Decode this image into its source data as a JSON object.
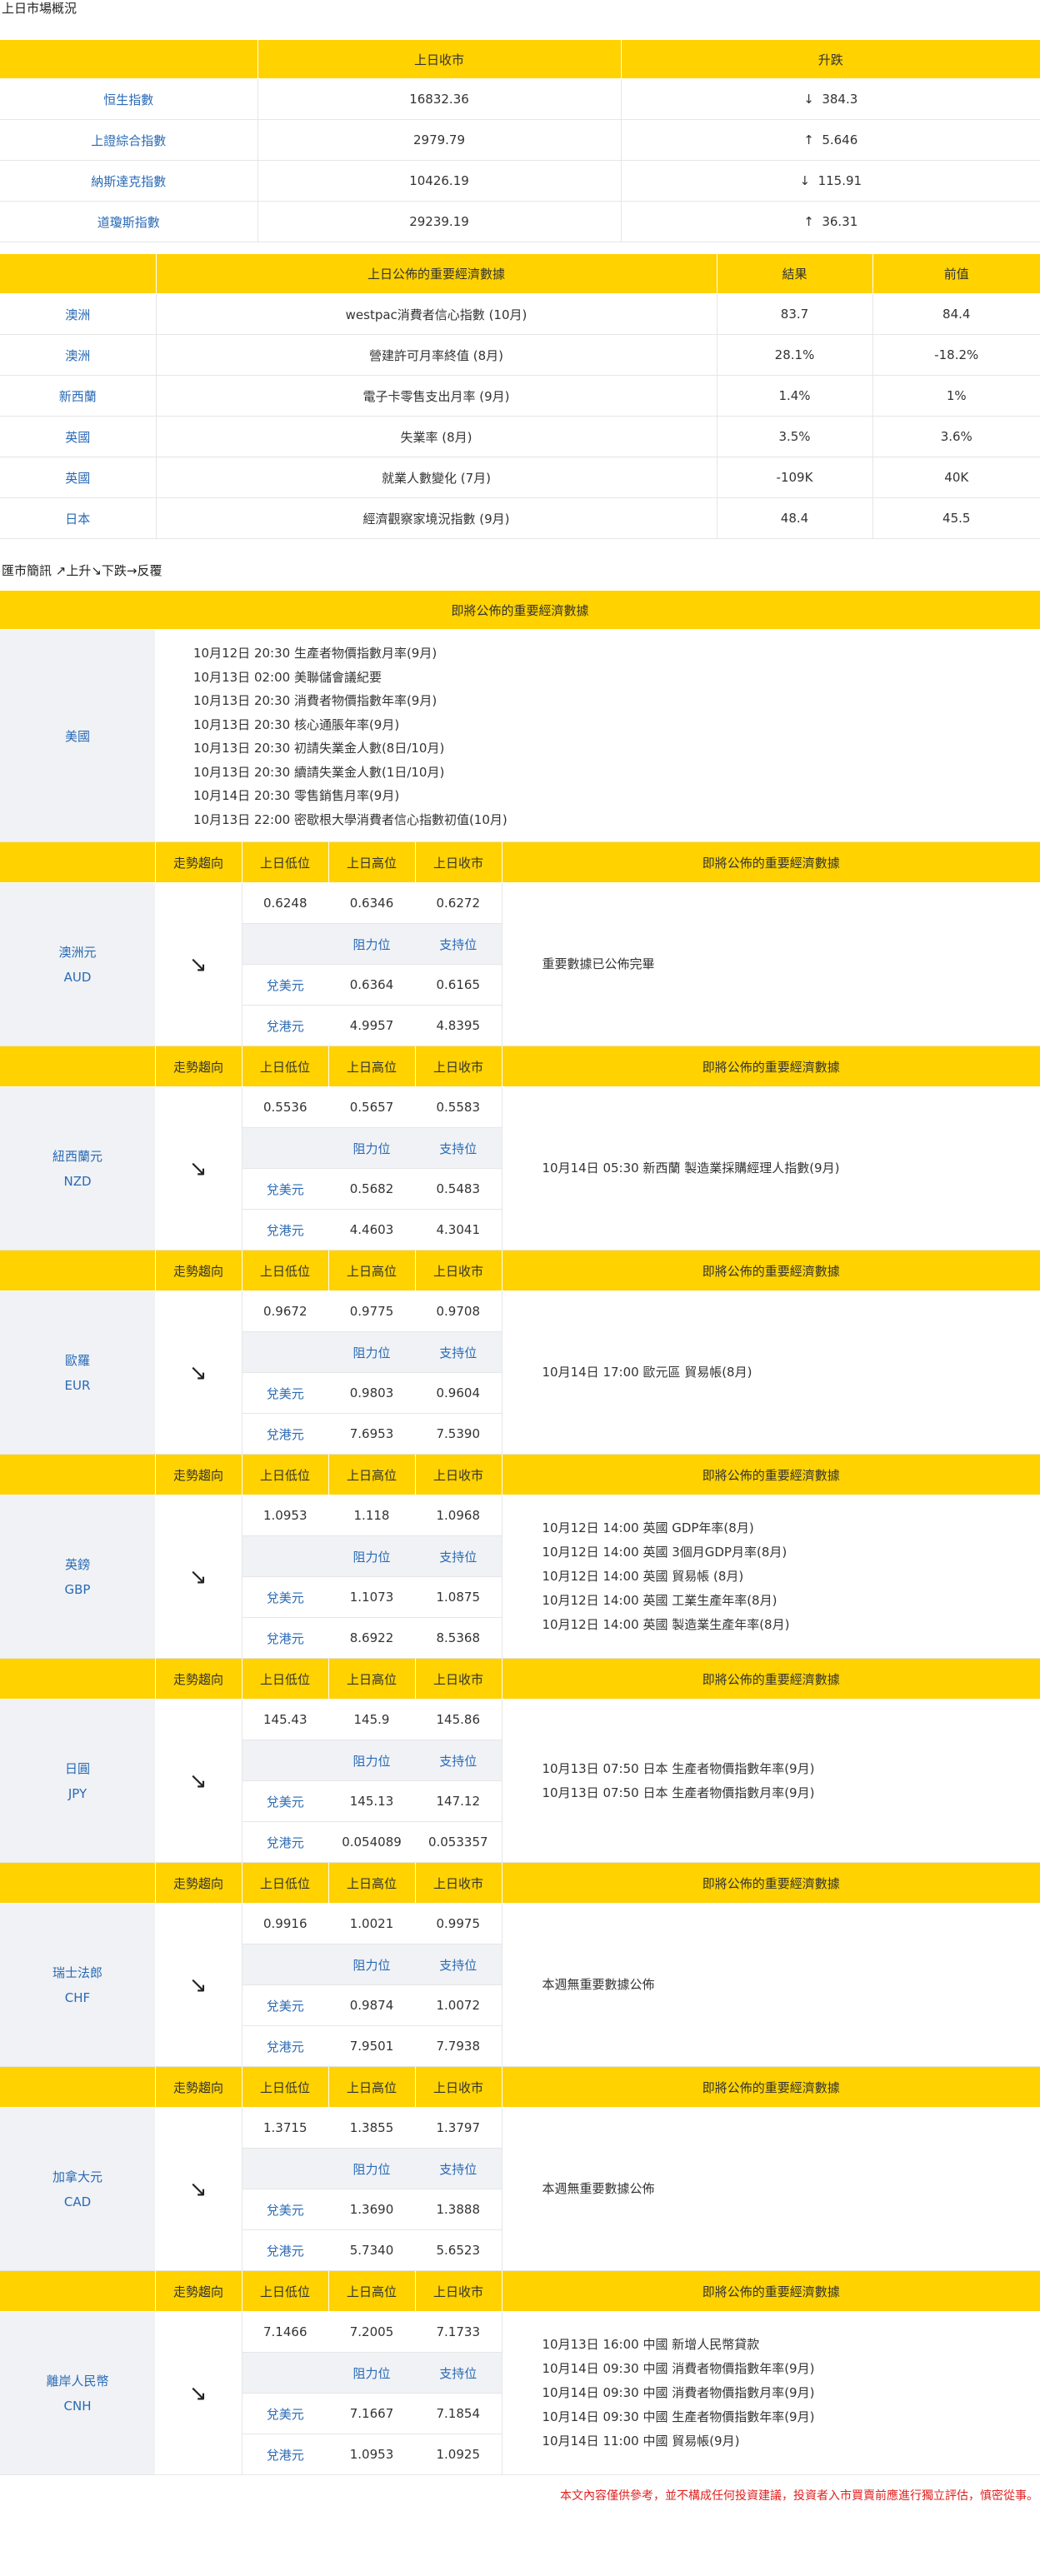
{
  "overview": {
    "title": "上日市場概況",
    "headers": [
      "",
      "上日收市",
      "升跌"
    ],
    "rows": [
      {
        "name": "恒生指數",
        "close": "16832.36",
        "dir": "↓",
        "change": "384.3"
      },
      {
        "name": "上證綜合指數",
        "close": "2979.79",
        "dir": "↑",
        "change": "5.646"
      },
      {
        "name": "納斯達克指數",
        "close": "10426.19",
        "dir": "↓",
        "change": "115.91"
      },
      {
        "name": "道瓊斯指數",
        "close": "29239.19",
        "dir": "↑",
        "change": "36.31"
      }
    ]
  },
  "economic": {
    "headers": [
      "",
      "上日公佈的重要經濟數據",
      "結果",
      "前值"
    ],
    "rows": [
      {
        "country": "澳洲",
        "item": "westpac消費者信心指數 (10月)",
        "result": "83.7",
        "prev": "84.4"
      },
      {
        "country": "澳洲",
        "item": "營建許可月率終值 (8月)",
        "result": "28.1%",
        "prev": "-18.2%"
      },
      {
        "country": "新西蘭",
        "item": "電子卡零售支出月率 (9月)",
        "result": "1.4%",
        "prev": "1%"
      },
      {
        "country": "英國",
        "item": "失業率 (8月)",
        "result": "3.5%",
        "prev": "3.6%"
      },
      {
        "country": "英國",
        "item": "就業人數變化 (7月)",
        "result": "-109K",
        "prev": "40K"
      },
      {
        "country": "日本",
        "item": "經濟觀察家境況指數 (9月)",
        "result": "48.4",
        "prev": "45.5"
      }
    ]
  },
  "fx": {
    "title": "匯市簡訊 ↗上升↘下跌→反覆",
    "us": {
      "header": "即將公佈的重要經濟數據",
      "country": "美國",
      "events": [
        "10月12日 20:30 生產者物價指數月率(9月)",
        "10月13日 02:00 美聯儲會議紀要",
        "10月13日 20:30 消費者物價指數年率(9月)",
        "10月13日 20:30 核心通脹年率(9月)",
        "10月13日 20:30 初請失業金人數(8日/10月)",
        "10月13日 20:30 續請失業金人數(1日/10月)",
        "10月14日 20:30 零售銷售月率(9月)",
        "10月13日 22:00 密歇根大學消費者信心指數初值(10月)"
      ]
    },
    "table_headers": {
      "trend": "走勢趨向",
      "low": "上日低位",
      "high": "上日高位",
      "close": "上日收市",
      "events": "即將公佈的重要經濟數據",
      "resistance": "阻力位",
      "support": "支持位",
      "vs_usd": "兌美元",
      "vs_hkd": "兌港元"
    },
    "currencies": [
      {
        "name": "澳洲元",
        "code": "AUD",
        "trend": "↘",
        "low": "0.6248",
        "high": "0.6346",
        "close": "0.6272",
        "usd_res": "0.6364",
        "usd_sup": "0.6165",
        "hkd_res": "4.9957",
        "hkd_sup": "4.8395",
        "events": [
          "重要數據已公佈完畢"
        ]
      },
      {
        "name": "紐西蘭元",
        "code": "NZD",
        "trend": "↘",
        "low": "0.5536",
        "high": "0.5657",
        "close": "0.5583",
        "usd_res": "0.5682",
        "usd_sup": "0.5483",
        "hkd_res": "4.4603",
        "hkd_sup": "4.3041",
        "events": [
          "10月14日 05:30 新西蘭 製造業採購經理人指數(9月)"
        ]
      },
      {
        "name": "歐羅",
        "code": "EUR",
        "trend": "↘",
        "low": "0.9672",
        "high": "0.9775",
        "close": "0.9708",
        "usd_res": "0.9803",
        "usd_sup": "0.9604",
        "hkd_res": "7.6953",
        "hkd_sup": "7.5390",
        "events": [
          "10月14日 17:00 歐元區 貿易帳(8月)"
        ]
      },
      {
        "name": "英鎊",
        "code": "GBP",
        "trend": "↘",
        "low": "1.0953",
        "high": "1.118",
        "close": "1.0968",
        "usd_res": "1.1073",
        "usd_sup": "1.0875",
        "hkd_res": "8.6922",
        "hkd_sup": "8.5368",
        "events": [
          "10月12日 14:00 英國 GDP年率(8月)",
          "10月12日 14:00 英國 3個月GDP月率(8月)",
          "10月12日 14:00 英國 貿易帳 (8月)",
          "10月12日 14:00 英國 工業生產年率(8月)",
          "10月12日 14:00 英國 製造業生產年率(8月)"
        ]
      },
      {
        "name": "日圓",
        "code": "JPY",
        "trend": "↘",
        "low": "145.43",
        "high": "145.9",
        "close": "145.86",
        "usd_res": "145.13",
        "usd_sup": "147.12",
        "hkd_res": "0.054089",
        "hkd_sup": "0.053357",
        "events": [
          "10月13日 07:50 日本 生產者物價指數年率(9月)",
          "10月13日 07:50 日本 生產者物價指數月率(9月)"
        ]
      },
      {
        "name": "瑞士法郎",
        "code": "CHF",
        "trend": "↘",
        "low": "0.9916",
        "high": "1.0021",
        "close": "0.9975",
        "usd_res": "0.9874",
        "usd_sup": "1.0072",
        "hkd_res": "7.9501",
        "hkd_sup": "7.7938",
        "events": [
          "本週無重要數據公佈"
        ]
      },
      {
        "name": "加拿大元",
        "code": "CAD",
        "trend": "↘",
        "low": "1.3715",
        "high": "1.3855",
        "close": "1.3797",
        "usd_res": "1.3690",
        "usd_sup": "1.3888",
        "hkd_res": "5.7340",
        "hkd_sup": "5.6523",
        "events": [
          "本週無重要數據公佈"
        ]
      },
      {
        "name": "離岸人民幣",
        "code": "CNH",
        "trend": "↘",
        "low": "7.1466",
        "high": "7.2005",
        "close": "7.1733",
        "usd_res": "7.1667",
        "usd_sup": "7.1854",
        "hkd_res": "1.0953",
        "hkd_sup": "1.0925",
        "events": [
          "10月13日 16:00 中國 新增人民幣貸款",
          "10月14日 09:30 中國 消費者物價指數年率(9月)",
          "10月14日 09:30 中國 消費者物價指數月率(9月)",
          "10月14日 09:30 中國 生產者物價指數年率(9月)",
          "10月14日 11:00 中國 貿易帳(9月)"
        ]
      }
    ]
  },
  "footer": {
    "disclaimer": "本文內容僅供參考，並不構成任何投資建議，投資者入市買賣前應進行獨立評估，慎密從事。"
  }
}
